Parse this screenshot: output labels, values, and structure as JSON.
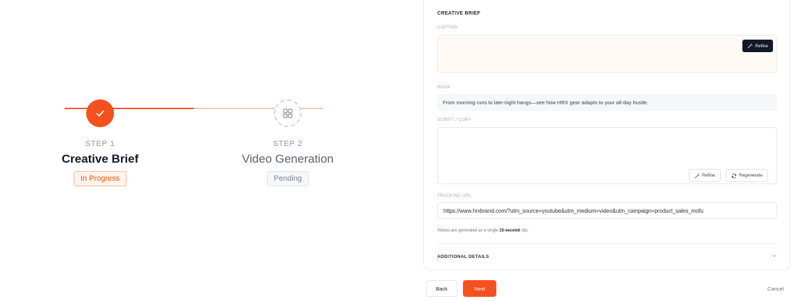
{
  "stepper": {
    "steps": [
      {
        "number": "STEP 1",
        "title": "Creative Brief",
        "status": "In Progress"
      },
      {
        "number": "STEP 2",
        "title": "Video Generation",
        "status": "Pending"
      }
    ]
  },
  "form": {
    "section_title": "CREATIVE BRIEF",
    "caption": {
      "label": "CAPTION",
      "value": "",
      "refine_label": "Refine"
    },
    "hook": {
      "label": "HOOK",
      "value": "From morning runs to late-night hangs—see how HRX gear adapts to your all-day hustle."
    },
    "script": {
      "label": "SCRIPT / COPY",
      "value": "",
      "refine_label": "Refine",
      "regenerate_label": "Regenerate"
    },
    "tracking": {
      "label": "TRACKING URL",
      "value": "https://www.hrxbrand.com/?utm_source=youtube&utm_medium=video&utm_campaign=product_sales_mofu"
    },
    "note": {
      "prefix": "Videos are generated as a single ",
      "emphasis": "15-second",
      "suffix": " clip."
    },
    "additional_details_label": "ADDITIONAL DETAILS"
  },
  "footer": {
    "back_label": "Back",
    "next_label": "Next",
    "cancel_label": "Cancel"
  },
  "colors": {
    "accent": "#f4511e",
    "dark_button": "#111827"
  }
}
